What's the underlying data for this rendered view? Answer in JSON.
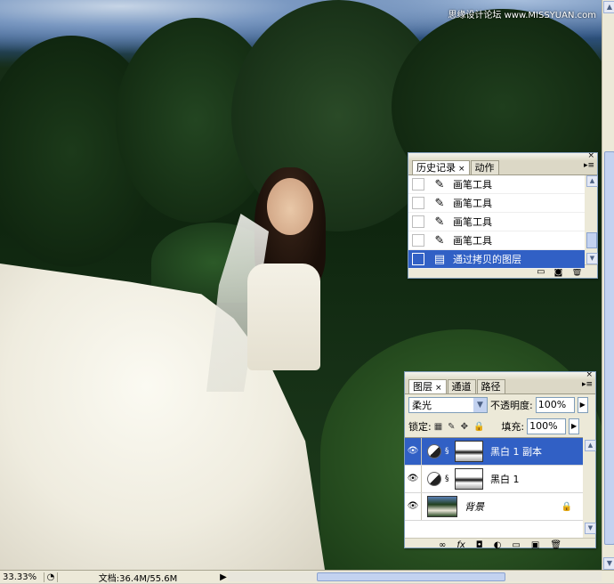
{
  "watermark": "思缘设计论坛 www.MISSYUAN.com",
  "history_panel": {
    "tabs": [
      {
        "label": "历史记录",
        "close": "×"
      },
      {
        "label": "动作"
      }
    ],
    "menu_icon": "panel-menu-icon",
    "items": [
      {
        "label": "画笔工具",
        "icon": "brush-icon"
      },
      {
        "label": "画笔工具",
        "icon": "brush-icon"
      },
      {
        "label": "画笔工具",
        "icon": "brush-icon"
      },
      {
        "label": "画笔工具",
        "icon": "brush-icon"
      },
      {
        "label": "通过拷贝的图层",
        "icon": "layer-copy-icon",
        "selected": true
      }
    ],
    "footer_icons": [
      "new-document-icon",
      "new-snapshot-icon",
      "delete-icon"
    ]
  },
  "layers_panel": {
    "tabs": [
      {
        "label": "图层",
        "close": "×"
      },
      {
        "label": "通道"
      },
      {
        "label": "路径"
      }
    ],
    "blend_mode": "柔光",
    "opacity_label": "不透明度:",
    "opacity_value": "100%",
    "lock_label": "锁定:",
    "fill_label": "填充:",
    "fill_value": "100%",
    "layers": [
      {
        "name": "黑白 1 副本",
        "type": "adjustment",
        "selected": true
      },
      {
        "name": "黑白 1",
        "type": "adjustment"
      },
      {
        "name": "背景",
        "type": "image",
        "locked": true
      }
    ],
    "footer_icons": [
      "link-icon",
      "fx-icon",
      "mask-icon",
      "adjustment-icon",
      "group-icon",
      "new-layer-icon",
      "delete-icon"
    ]
  },
  "status": {
    "zoom": "33.33%",
    "doc_info": "文档:36.4M/55.6M"
  }
}
